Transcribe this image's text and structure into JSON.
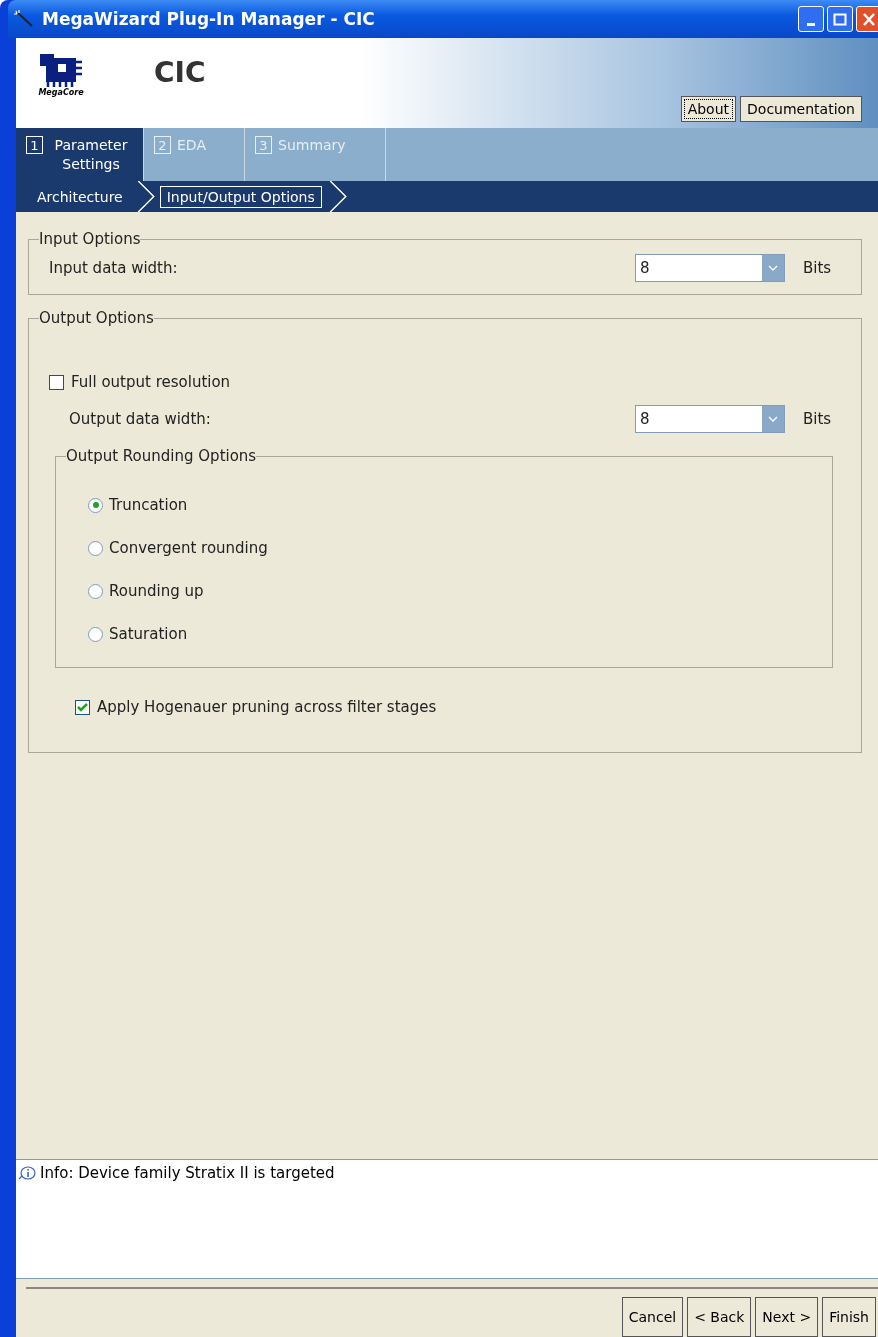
{
  "window": {
    "title": "MegaWizard Plug-In Manager - CIC"
  },
  "header": {
    "logo_text": "MegaCore",
    "title": "CIC",
    "buttons": [
      {
        "label": "About",
        "focused": true
      },
      {
        "label": "Documentation",
        "focused": false
      }
    ]
  },
  "tabs": [
    {
      "number": "1",
      "label": "Parameter Settings",
      "selected": true
    },
    {
      "number": "2",
      "label": "EDA",
      "selected": false
    },
    {
      "number": "3",
      "label": "Summary",
      "selected": false
    }
  ],
  "breadcrumb": [
    {
      "label": "Architecture",
      "selected": false
    },
    {
      "label": "Input/Output Options",
      "selected": true
    }
  ],
  "input_options": {
    "title": "Input Options",
    "label": "Input data width:",
    "value": "8",
    "unit": "Bits"
  },
  "output_options": {
    "title": "Output Options",
    "full_resolution": {
      "label": "Full output resolution",
      "checked": false
    },
    "label": "Output data width:",
    "value": "8",
    "unit": "Bits",
    "rounding": {
      "title": "Output Rounding Options",
      "options": [
        {
          "label": "Truncation",
          "selected": true
        },
        {
          "label": "Convergent rounding",
          "selected": false
        },
        {
          "label": "Rounding up",
          "selected": false
        },
        {
          "label": "Saturation",
          "selected": false
        }
      ]
    },
    "pruning": {
      "label": "Apply Hogenauer pruning across filter stages",
      "checked": true
    }
  },
  "messages": [
    {
      "text": "Info: Device family Stratix II is targeted"
    }
  ],
  "footer_buttons": [
    "Cancel",
    "< Back",
    "Next >",
    "Finish"
  ]
}
